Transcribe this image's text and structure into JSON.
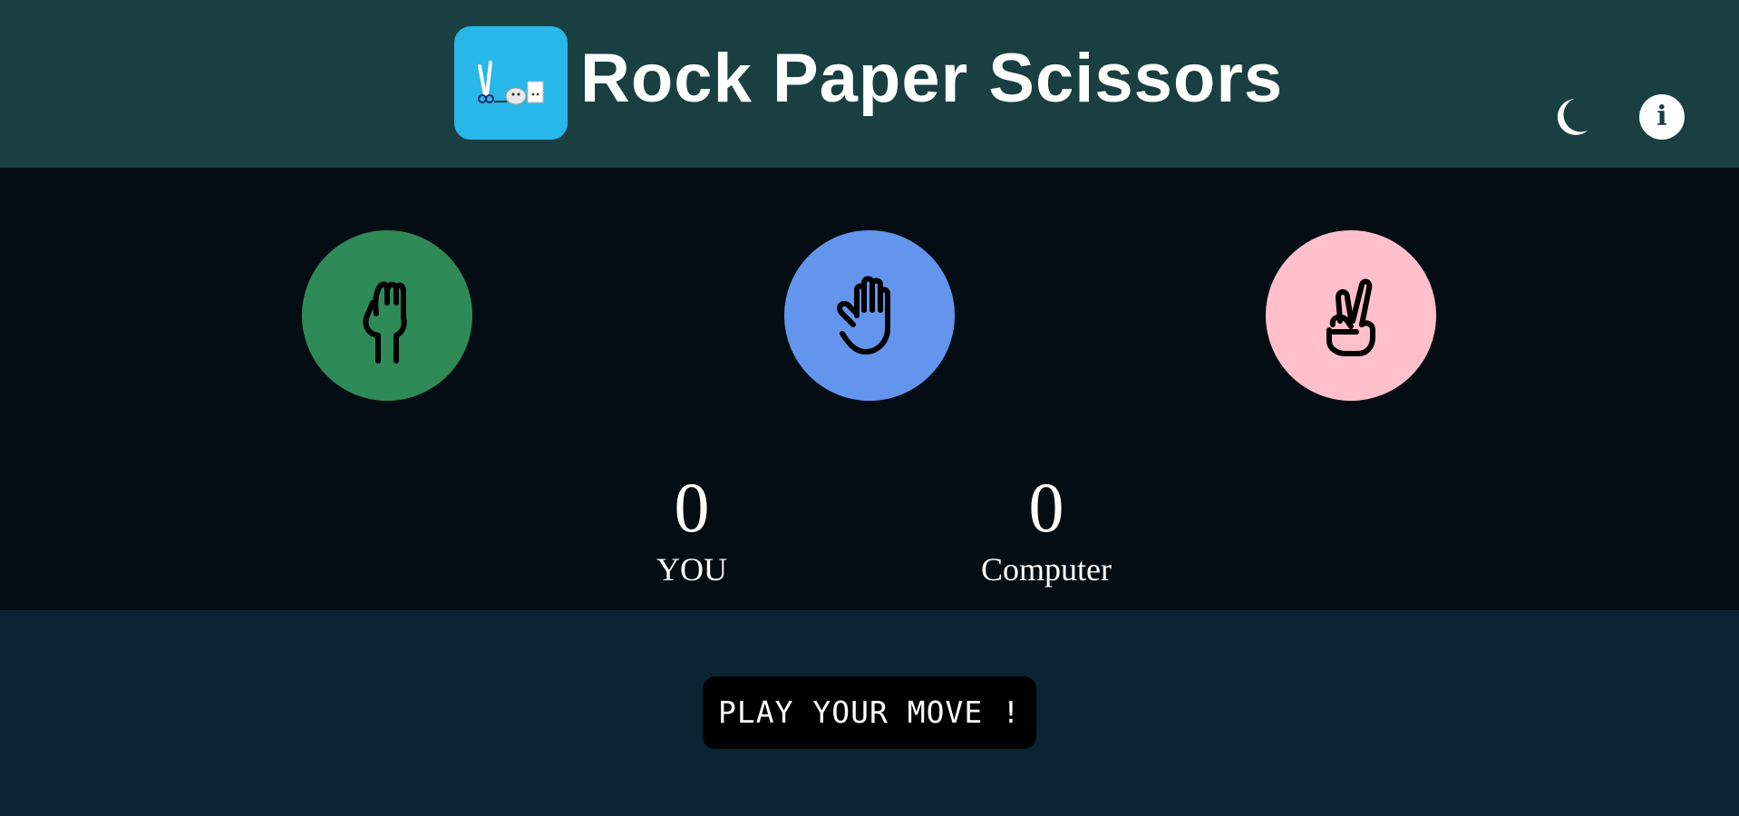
{
  "header": {
    "title": "Rock Paper Scissors",
    "logo_icon": "rock-paper-scissors-logo-icon",
    "theme_toggle_icon": "moon-icon",
    "info_icon": "info-icon",
    "info_glyph": "i"
  },
  "moves": [
    {
      "name": "rock",
      "icon": "fist-icon",
      "color": "#2e8b57"
    },
    {
      "name": "paper",
      "icon": "open-hand-icon",
      "color": "#6495ed"
    },
    {
      "name": "scissors",
      "icon": "victory-hand-icon",
      "color": "#ffc0cb"
    }
  ],
  "scoreboard": {
    "player": {
      "score": "0",
      "label": "YOU"
    },
    "computer": {
      "score": "0",
      "label": "Computer"
    }
  },
  "action": {
    "play_label": "PLAY YOUR MOVE !"
  },
  "colors": {
    "header_bg": "#193f41",
    "arena_bg": "#040d13",
    "footer_bg": "#0a2433",
    "logo_bg": "#29b6e8"
  }
}
